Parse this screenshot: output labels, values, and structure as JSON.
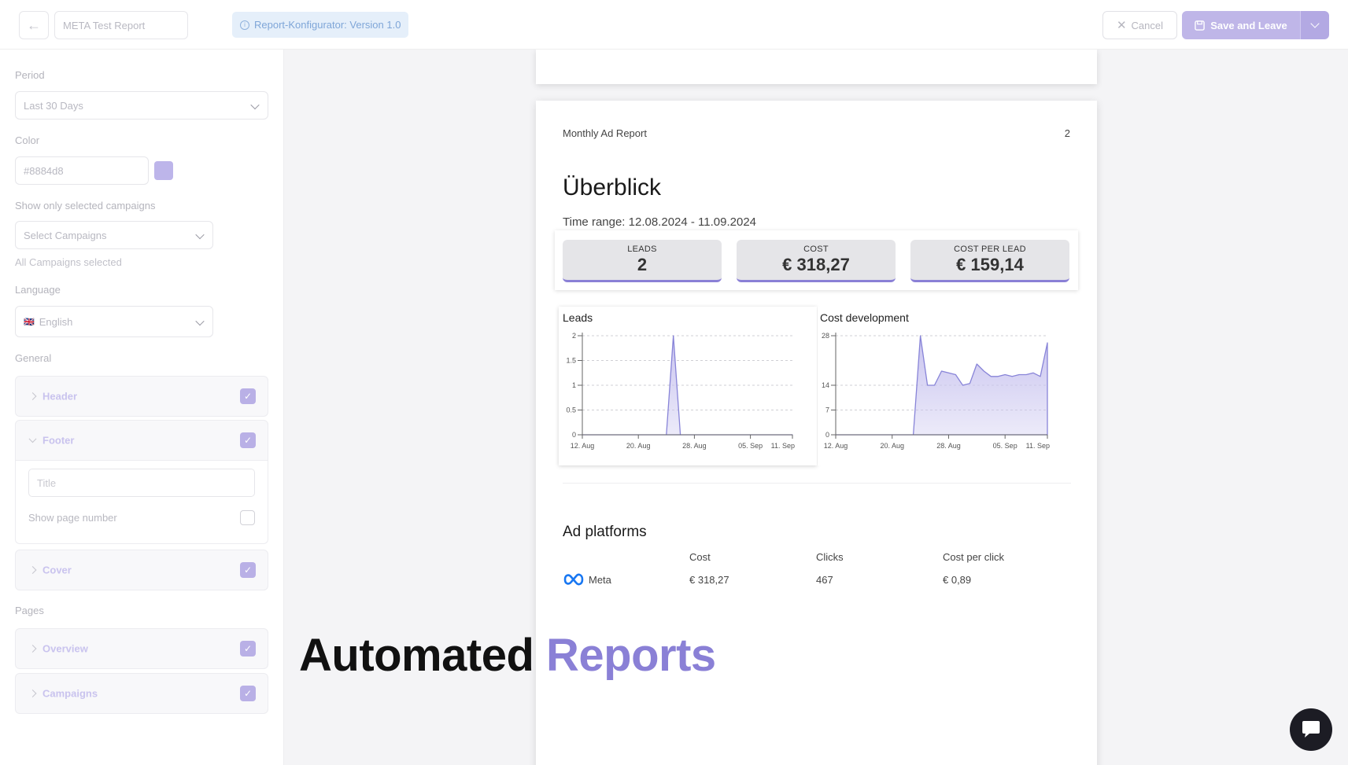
{
  "topbar": {
    "report_name": "META Test Report",
    "version_badge": "Report-Konfigurator: Version 1.0",
    "cancel_label": "Cancel",
    "save_label": "Save and Leave"
  },
  "sidebar": {
    "period_label": "Period",
    "period_value": "Last 30 Days",
    "color_label": "Color",
    "color_value": "#8884d8",
    "campaigns_label": "Show only selected campaigns",
    "campaigns_placeholder": "Select Campaigns",
    "campaigns_hint": "All Campaigns selected",
    "language_label": "Language",
    "language_flag": "🇬🇧",
    "language_value": "English",
    "general_label": "General",
    "header_label": "Header",
    "footer_label": "Footer",
    "footer_title_placeholder": "Title",
    "show_page_number_label": "Show page number",
    "cover_label": "Cover",
    "pages_label": "Pages",
    "overview_label": "Overview",
    "campaigns_page_label": "Campaigns"
  },
  "report": {
    "header_title": "Monthly Ad Report",
    "page_number": "2",
    "section_title": "Überblick",
    "time_range": "Time range: 12.08.2024 - 11.09.2024",
    "kpis": [
      {
        "label": "LEADS",
        "value": "2"
      },
      {
        "label": "COST",
        "value": "€ 318,27"
      },
      {
        "label": "COST PER LEAD",
        "value": "€ 159,14"
      }
    ],
    "ad_platforms_title": "Ad platforms",
    "ad_columns": [
      "Cost",
      "Clicks",
      "Cost per click"
    ],
    "ad_rows": [
      {
        "platform": "Meta",
        "cost": "€ 318,27",
        "clicks": "467",
        "cpc": "€ 0,89"
      }
    ]
  },
  "overlay": {
    "word1": "Automated",
    "word2": "Reports"
  },
  "colors": {
    "accent": "#8884d8",
    "accent_fill": "#c9c4ef"
  },
  "chart_data": [
    {
      "type": "area",
      "title": "Leads",
      "x_ticks": [
        "12. Aug",
        "20. Aug",
        "28. Aug",
        "05. Sep",
        "11. Sep"
      ],
      "y_ticks": [
        "0",
        "0.5",
        "1",
        "1.5",
        "2"
      ],
      "ylim": [
        0,
        2
      ],
      "days": 31,
      "values": [
        0,
        0,
        0,
        0,
        0,
        0,
        0,
        0,
        0,
        0,
        0,
        0,
        0,
        2,
        0,
        0,
        0,
        0,
        0,
        0,
        0,
        0,
        0,
        0,
        0,
        0,
        0,
        0,
        0,
        0,
        0
      ]
    },
    {
      "type": "area",
      "title": "Cost development",
      "x_ticks": [
        "12. Aug",
        "20. Aug",
        "28. Aug",
        "05. Sep",
        "11. Sep"
      ],
      "y_ticks": [
        "0",
        "7",
        "14",
        "28"
      ],
      "ylim": [
        0,
        28
      ],
      "days": 31,
      "values": [
        0,
        0,
        0,
        0,
        0,
        0,
        0,
        0,
        0,
        0,
        0,
        0,
        28,
        14,
        14,
        18,
        17.5,
        17,
        14,
        14.5,
        20,
        18,
        16.5,
        16.5,
        17,
        16.5,
        17,
        17,
        17.5,
        16.5,
        26
      ]
    }
  ]
}
